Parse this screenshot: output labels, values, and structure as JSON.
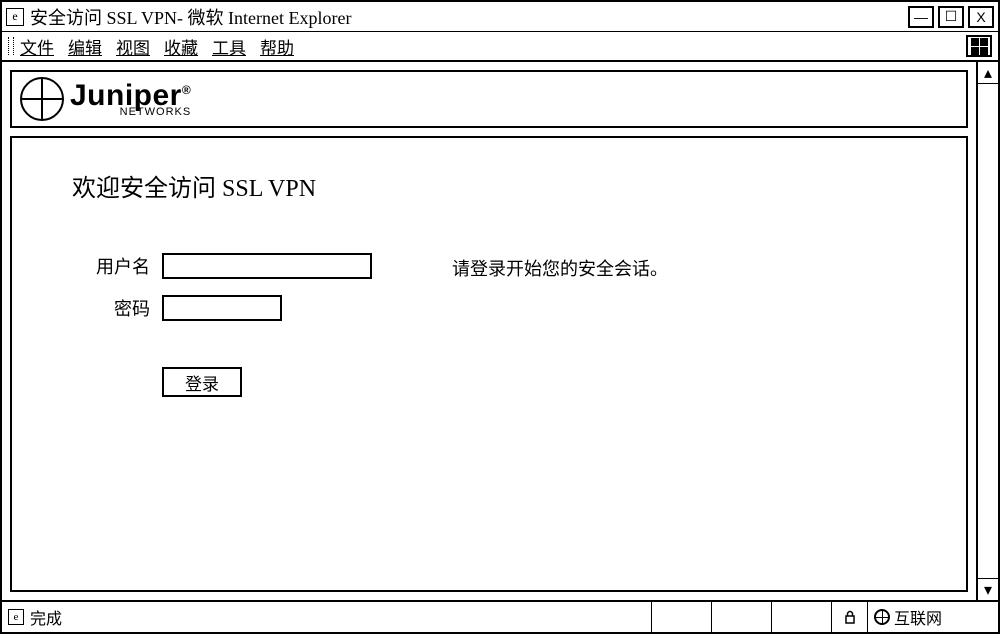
{
  "window": {
    "title": "安全访问 SSL VPN- 微软 Internet Explorer"
  },
  "menu": {
    "file": "文件",
    "edit": "编辑",
    "view": "视图",
    "favorites": "收藏",
    "tools": "工具",
    "help": "帮助"
  },
  "brand": {
    "name": "Juniper",
    "sub": "NETWORKS",
    "reg": "®"
  },
  "page": {
    "welcome": "欢迎安全访问 SSL VPN",
    "username_label": "用户名",
    "password_label": "密码",
    "username_value": "",
    "password_value": "",
    "login_button": "登录",
    "hint": "请登录开始您的安全会话。"
  },
  "statusbar": {
    "status": "完成",
    "zone": "互联网"
  }
}
